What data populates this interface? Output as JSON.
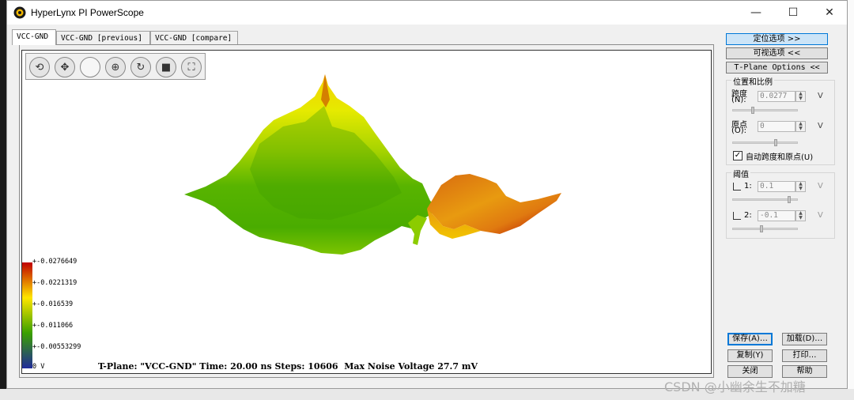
{
  "window": {
    "title": "HyperLynx PI PowerScope",
    "minimize_glyph": "—",
    "maximize_glyph": "☐",
    "close_glyph": "✕"
  },
  "tabs": [
    {
      "label": "VCC-GND",
      "active": true
    },
    {
      "label": "VCC-GND [previous]",
      "active": false
    },
    {
      "label": "VCC-GND [compare]",
      "active": false
    }
  ],
  "toolbar_icons": [
    "rotate-icon",
    "move-icon",
    "blank-icon",
    "center-icon",
    "refresh-icon",
    "stop-icon",
    "fit-icon"
  ],
  "colorbar": {
    "labels": [
      "+-0.0276649",
      "+-0.0221319",
      "+-0.016539",
      "+-0.011066",
      "+-0.00553299",
      "0 V"
    ],
    "colors": [
      "#c00000",
      "#ffe600",
      "#3aa000",
      "#202a9a"
    ]
  },
  "status": {
    "text": "T-Plane: \"VCC-GND\" Time: 20.00 ns Steps: 10606  Max Noise Voltage 27.7 mV"
  },
  "right_panel": {
    "location_options": "定位选项 >>",
    "visual_options": "可视选项 <<",
    "tplane_options": "T-Plane Options <<",
    "position_group": {
      "title": "位置和比例",
      "span_label_top": "跨度",
      "span_label_bottom": "(N):",
      "span_value": "0.0277",
      "span_unit": "V",
      "origin_label_top": "原点",
      "origin_label_bottom": "(O):",
      "origin_value": "0",
      "origin_unit": "V",
      "auto_label": "自动跨度和原点(U)",
      "auto_checked": "✓"
    },
    "threshold_group": {
      "title": "阈值",
      "t1_label": "1:",
      "t1_value": "0.1",
      "t1_unit": "V",
      "t2_label": "2:",
      "t2_value": "-0.1",
      "t2_unit": "V"
    },
    "buttons": {
      "save": "保存(A)…",
      "load": "加载(D)…",
      "copy": "复制(Y)",
      "print": "打印…",
      "close": "关闭",
      "help": "帮助"
    }
  },
  "watermark": "CSDN @小幽余生不加糖"
}
